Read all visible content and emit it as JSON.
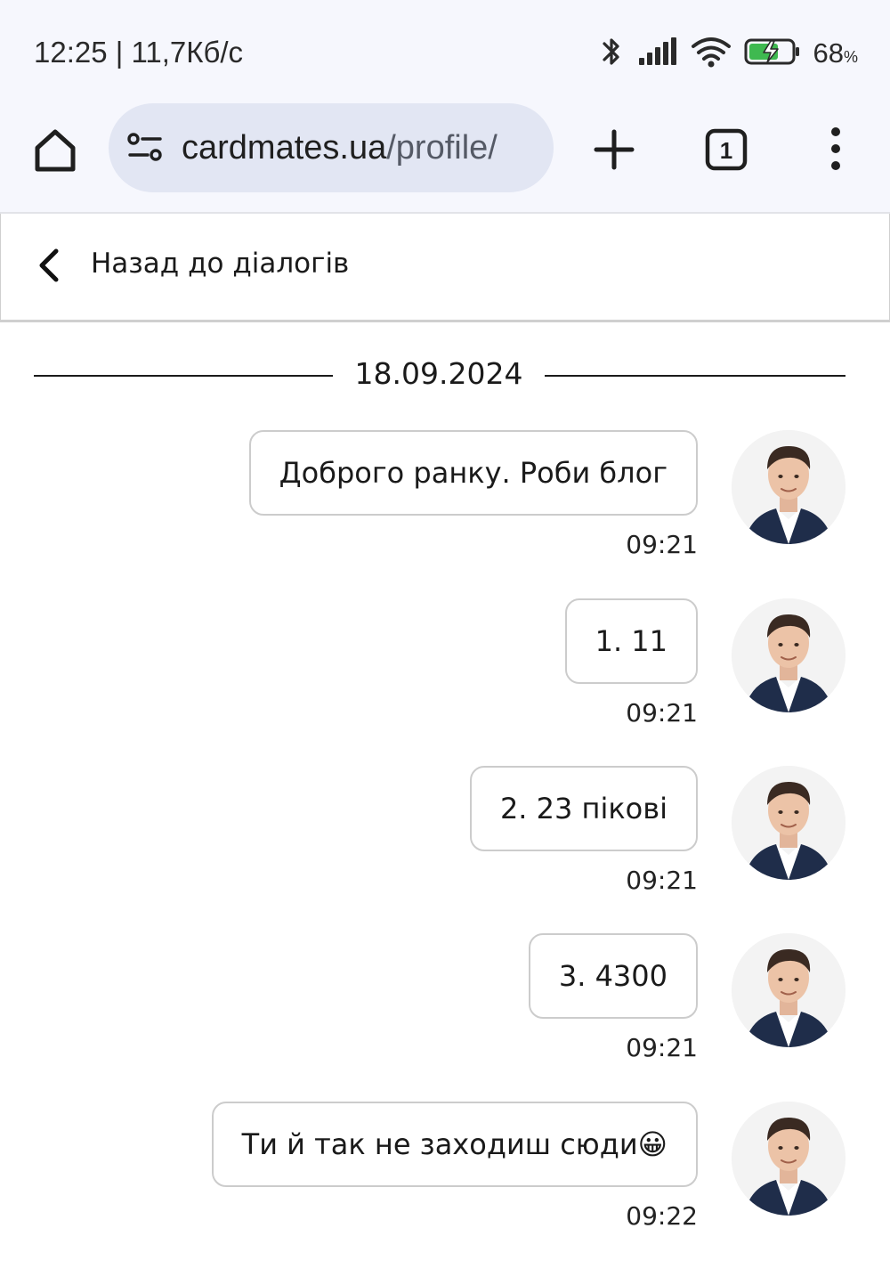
{
  "status_bar": {
    "time_speed": "12:25 | 11,7Кб/с",
    "battery_percent": "68",
    "battery_unit": "%",
    "icons": [
      "bluetooth-icon",
      "signal-icon",
      "wifi-icon",
      "battery-charging-icon"
    ]
  },
  "browser": {
    "url_domain": "cardmates.ua",
    "url_path": "/profile/",
    "tab_count": "1",
    "icons": [
      "home-icon",
      "site-settings-icon",
      "plus-icon",
      "tabs-icon",
      "more-vert-icon"
    ]
  },
  "chat": {
    "back_label": "Назад до діалогів",
    "date": "18.09.2024",
    "messages": [
      {
        "text": "Доброго ранку. Роби блог",
        "time": "09:21"
      },
      {
        "text": "1. 11",
        "time": "09:21"
      },
      {
        "text": "2. 23 пікові",
        "time": "09:21"
      },
      {
        "text": "3. 4300",
        "time": "09:21"
      },
      {
        "text": "Ти й так не заходиш сюди😀",
        "time": "09:22"
      }
    ]
  },
  "colors": {
    "chrome_bg": "#f6f7fd",
    "urlbar_bg": "#e2e6f3",
    "bubble_border": "#cccccc",
    "battery_green": "#3fb950"
  }
}
